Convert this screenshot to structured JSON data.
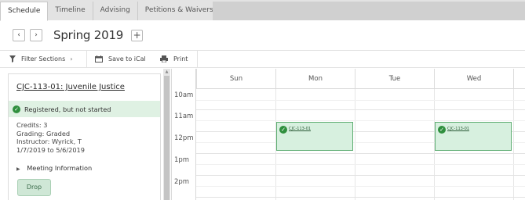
{
  "tabs": [
    {
      "label": "Schedule",
      "active": true
    },
    {
      "label": "Timeline",
      "active": false
    },
    {
      "label": "Advising",
      "active": false
    },
    {
      "label": "Petitions & Waivers",
      "active": false
    }
  ],
  "term": {
    "prev_symbol": "‹",
    "next_symbol": "›",
    "title": "Spring 2019",
    "add_symbol": "+"
  },
  "toolbar": {
    "filter_label": "Filter Sections",
    "filter_caret": "›",
    "save_label": "Save to iCal",
    "print_label": "Print"
  },
  "course": {
    "title": "CJC-113-01: Juvenile Justice",
    "status": "Registered, but not started",
    "credits": "Credits: 3",
    "grading": "Grading: Graded",
    "instructor": "Instructor: Wyrick, T",
    "dates": "1/7/2019 to 5/6/2019",
    "meeting_label": "Meeting Information",
    "drop_label": "Drop"
  },
  "calendar": {
    "days": [
      "Sun",
      "Mon",
      "Tue",
      "Wed"
    ],
    "times": [
      "10am",
      "11am",
      "12pm",
      "1pm",
      "2pm"
    ],
    "events": [
      {
        "day": "Mon",
        "label": "CJC-113-01",
        "start": "11:30am",
        "end": "12:45pm"
      },
      {
        "day": "Wed",
        "label": "CJC-113-01",
        "start": "11:30am",
        "end": "12:45pm"
      }
    ]
  },
  "colors": {
    "status_bg": "#dff1e3",
    "event_bg": "#d7f0df",
    "event_border": "#5fae73",
    "check_green": "#2f8f3e"
  }
}
